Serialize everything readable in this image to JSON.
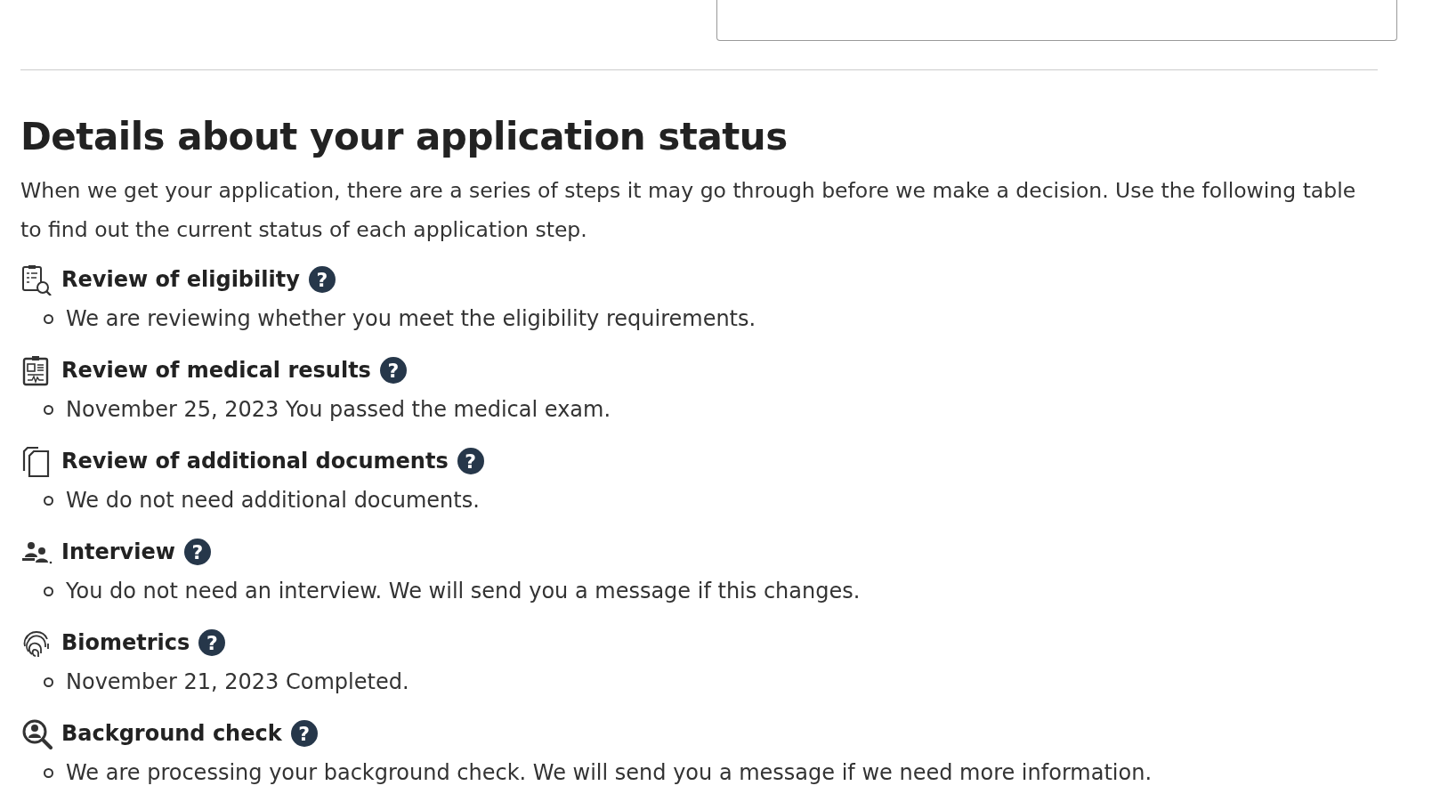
{
  "heading": "Details about your application status",
  "intro": "When we get your application, there are a series of steps it may go through before we make a decision. Use the following table to find out the current status of each application step.",
  "steps": [
    {
      "kind": "eligibility",
      "title": "Review of eligibility",
      "help": "?",
      "details": [
        "We are reviewing whether you meet the eligibility requirements."
      ]
    },
    {
      "kind": "medical",
      "title": "Review of medical results",
      "help": "?",
      "details": [
        "November 25, 2023 You passed the medical exam."
      ]
    },
    {
      "kind": "documents",
      "title": "Review of additional documents",
      "help": "?",
      "details": [
        "We do not need additional documents."
      ]
    },
    {
      "kind": "interview",
      "title": "Interview",
      "help": "?",
      "details": [
        "You do not need an interview. We will send you a message if this changes."
      ]
    },
    {
      "kind": "biometrics",
      "title": "Biometrics",
      "help": "?",
      "details": [
        "November 21, 2023 Completed."
      ]
    },
    {
      "kind": "background",
      "title": "Background check",
      "help": "?",
      "details": [
        "We are processing your background check. We will send you a message if we need more information."
      ]
    }
  ]
}
